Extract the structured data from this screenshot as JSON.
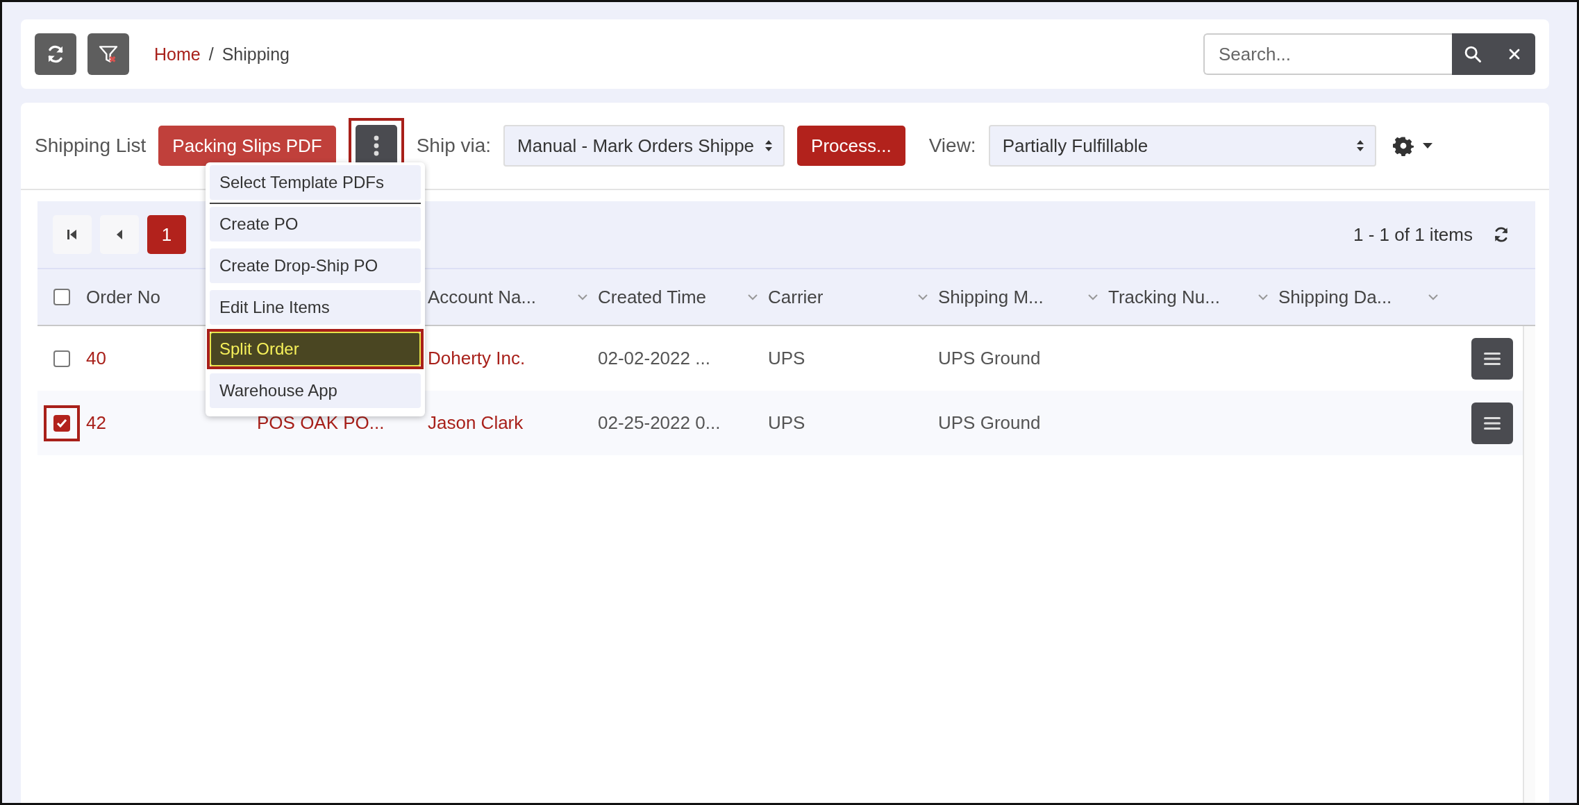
{
  "breadcrumb": {
    "separator": "/",
    "items": [
      {
        "label": "Home",
        "kind": "link"
      },
      {
        "label": "Shipping",
        "kind": "current"
      }
    ]
  },
  "search": {
    "placeholder": "Search..."
  },
  "toolbar": {
    "title": "Shipping List",
    "pdf_button": "Packing Slips PDF",
    "more_button": {
      "annotated": true
    },
    "ship_via_label": "Ship via:",
    "ship_via_value": "Manual - Mark Orders Shippe",
    "process_button": "Process...",
    "view_label": "View:",
    "view_value": "Partially Fulfillable"
  },
  "menu": [
    {
      "label": "Select Template PDFs",
      "highlighted": false,
      "annotated": false,
      "divider": true
    },
    {
      "label": "Create PO",
      "highlighted": false,
      "annotated": false,
      "divider": false
    },
    {
      "label": "Create Drop-Ship PO",
      "highlighted": false,
      "annotated": false,
      "divider": false
    },
    {
      "label": "Edit Line Items",
      "highlighted": false,
      "annotated": false,
      "divider": false
    },
    {
      "label": "Split Order",
      "highlighted": true,
      "annotated": true,
      "divider": false
    },
    {
      "label": "Warehouse App",
      "highlighted": false,
      "annotated": false,
      "divider": false
    }
  ],
  "pager": {
    "pages": [
      {
        "label": "1",
        "selected": true
      }
    ],
    "info": "1 - 1 of 1 items"
  },
  "table": {
    "header_checkbox": {
      "checked": false
    },
    "columns": [
      {
        "kind": "plain",
        "label": "Order No"
      },
      {
        "kind": "covered"
      },
      {
        "kind": "sortable",
        "label": "Account Na..."
      },
      {
        "kind": "sortable",
        "label": "Created Time"
      },
      {
        "kind": "sortable",
        "label": "Carrier"
      },
      {
        "kind": "sortable",
        "label": "Shipping M..."
      },
      {
        "kind": "sortable",
        "label": "Tracking Nu..."
      },
      {
        "kind": "sortable",
        "label": "Shipping Da..."
      }
    ],
    "rows": [
      {
        "checked": false,
        "annotated": false,
        "cells": [
          {
            "kind": "link",
            "text": "40"
          },
          {
            "kind": "covered"
          },
          {
            "kind": "link",
            "text": "Doherty Inc."
          },
          {
            "kind": "text",
            "text": "02-02-2022 ..."
          },
          {
            "kind": "text",
            "text": "UPS"
          },
          {
            "kind": "text",
            "text": "UPS Ground"
          }
        ]
      },
      {
        "checked": true,
        "annotated": true,
        "cells": [
          {
            "kind": "link",
            "text": "42"
          },
          {
            "kind": "link",
            "text": "POS OAK PO..."
          },
          {
            "kind": "link",
            "text": "Jason Clark"
          },
          {
            "kind": "text",
            "text": "02-25-2022 0..."
          },
          {
            "kind": "text",
            "text": "UPS"
          },
          {
            "kind": "text",
            "text": "UPS Ground"
          }
        ]
      }
    ]
  }
}
